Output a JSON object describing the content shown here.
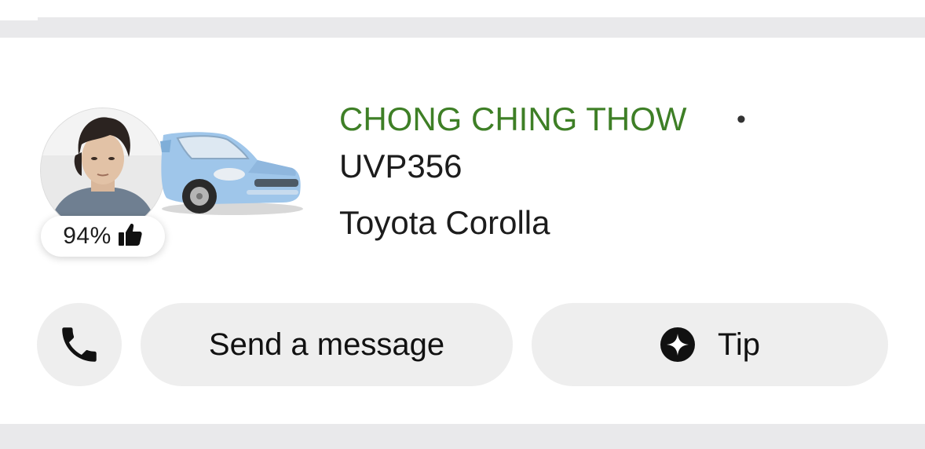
{
  "driver": {
    "rating": "94%",
    "name": "CHONG CHING THOW",
    "separator": "•",
    "plate": "UVP356",
    "car_model": "Toyota Corolla"
  },
  "actions": {
    "message_label": "Send a message",
    "tip_label": "Tip"
  },
  "icons": {
    "call": "phone-icon",
    "tip": "sparkle-badge-icon",
    "rating": "thumbs-up-icon"
  },
  "colors": {
    "name_green": "#3e7f26",
    "button_bg": "#eeeeee",
    "divider": "#e9e9eb"
  }
}
